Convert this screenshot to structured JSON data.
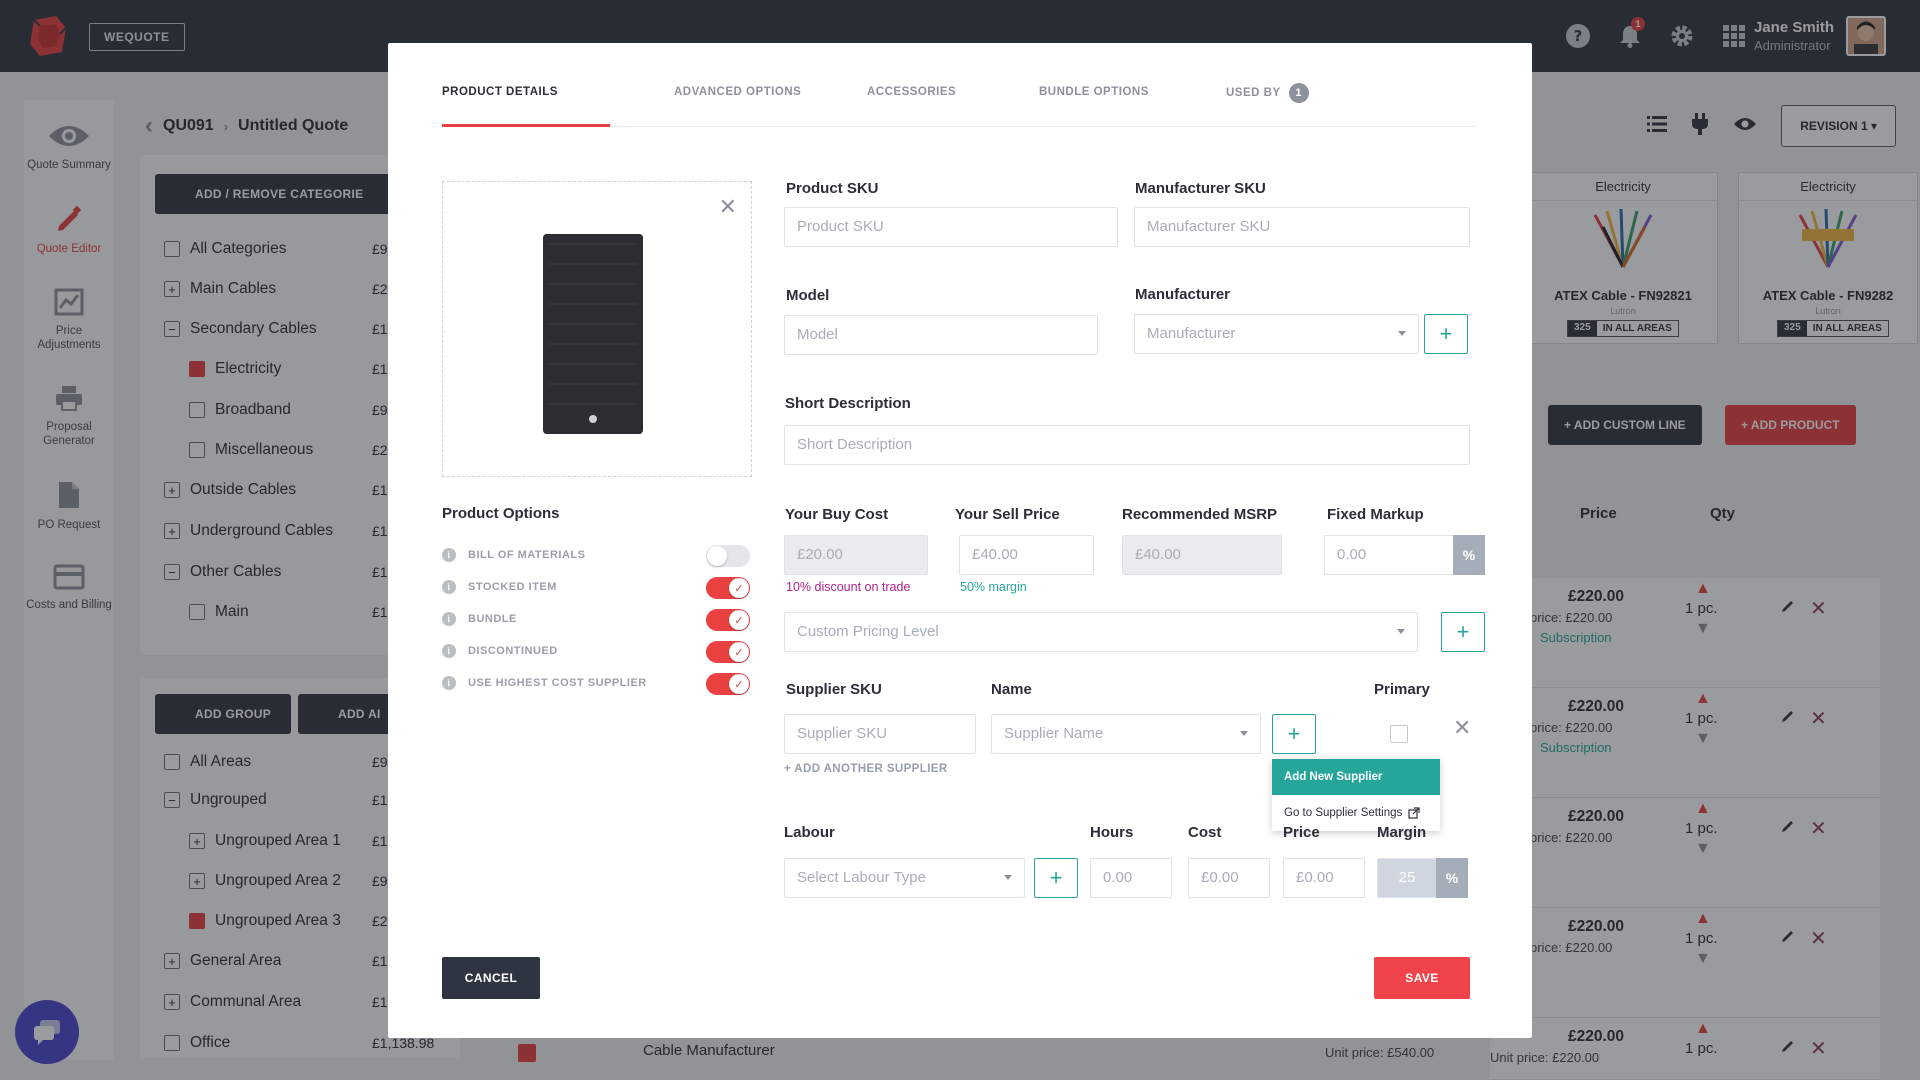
{
  "topbar": {
    "brand": "WEQUOTE",
    "notifications": "1",
    "user_name": "Jane Smith",
    "user_role": "Administrator"
  },
  "rail": [
    {
      "icon": "eye-icon",
      "label": "Quote Summary"
    },
    {
      "icon": "pencil-icon",
      "label": "Quote Editor"
    },
    {
      "icon": "chart-icon",
      "label": "Price Adjustments"
    },
    {
      "icon": "printer-icon",
      "label": "Proposal Generator"
    },
    {
      "icon": "document-icon",
      "label": "PO Request"
    },
    {
      "icon": "card-icon",
      "label": "Costs and Billing"
    }
  ],
  "quote": {
    "id": "QU091",
    "name": "Untitled Quote",
    "revision": "REVISION 1"
  },
  "categories_btn": "ADD / REMOVE CATEGORIE",
  "categories": [
    {
      "label": "All Categories",
      "price": "£9"
    },
    {
      "label": "Main Cables",
      "price": "£2"
    },
    {
      "label": "Secondary Cables",
      "price": "£1"
    },
    {
      "label": "Electricity",
      "price": "£1"
    },
    {
      "label": "Broadband",
      "price": "£9"
    },
    {
      "label": "Miscellaneous",
      "price": "£2"
    },
    {
      "label": "Outside Cables",
      "price": "£1"
    },
    {
      "label": "Underground Cables",
      "price": "£1"
    },
    {
      "label": "Other Cables",
      "price": "£1"
    },
    {
      "label": "Main",
      "price": "£1"
    }
  ],
  "groups_btns": {
    "add_group": "ADD GROUP",
    "add_area": "ADD AI"
  },
  "areas": [
    {
      "label": "All Areas",
      "price": "£9"
    },
    {
      "label": "Ungrouped",
      "price": "£1"
    },
    {
      "label": "Ungrouped Area 1",
      "price": "£1"
    },
    {
      "label": "Ungrouped Area 2",
      "price": "£9"
    },
    {
      "label": "Ungrouped Area 3",
      "price": "£2"
    },
    {
      "label": "General Area",
      "price": "£1"
    },
    {
      "label": "Communal Area",
      "price": "£1"
    },
    {
      "label": "Office",
      "price": "£1,138.98"
    }
  ],
  "cards": [
    {
      "head": "Electricity",
      "name": "ATEX Cable - FN92821",
      "brand": "Lutron",
      "stock": "325",
      "stock_label": "IN ALL AREAS"
    },
    {
      "head": "Electricity",
      "name": "ATEX Cable - FN9282",
      "brand": "Lutron",
      "stock": "325",
      "stock_label": "IN ALL AREAS"
    }
  ],
  "bg_buttons": {
    "custom_line": "ADD CUSTOM LINE",
    "add_product": "ADD PRODUCT"
  },
  "bg_columns": {
    "price": "Price",
    "qty": "Qty"
  },
  "lines": [
    {
      "price": "£220.00",
      "unit": "price: £220.00",
      "sub": "Subscription",
      "qty": "1 pc."
    },
    {
      "price": "£220.00",
      "unit": "price: £220.00",
      "sub": "Subscription",
      "qty": "1 pc."
    },
    {
      "price": "£220.00",
      "unit": "price: £220.00",
      "sub": "",
      "qty": "1 pc."
    },
    {
      "price": "£220.00",
      "unit": "price: £220.00",
      "sub": "",
      "qty": "1 pc."
    },
    {
      "price": "£220.00",
      "unit": "Unit price: £220.00",
      "sub": "",
      "qty": "1 pc."
    }
  ],
  "bottom_row": {
    "label": "Cable Manufacturer",
    "unit": "Unit price: £540.00"
  },
  "modal": {
    "tabs": [
      "PRODUCT DETAILS",
      "ADVANCED OPTIONS",
      "ACCESSORIES",
      "BUNDLE OPTIONS",
      "USED BY"
    ],
    "used_by_count": "1",
    "product_sku_label": "Product SKU",
    "product_sku_ph": "Product SKU",
    "manufacturer_sku_label": "Manufacturer SKU",
    "manufacturer_sku_ph": "Manufacturer SKU",
    "model_label": "Model",
    "model_ph": "Model",
    "manufacturer_label": "Manufacturer",
    "manufacturer_ph": "Manufacturer",
    "short_desc_label": "Short Description",
    "short_desc_ph": "Short Description",
    "product_options_label": "Product Options",
    "options": [
      {
        "label": "BILL OF MATERIALS",
        "on": false
      },
      {
        "label": "STOCKED ITEM",
        "on": true
      },
      {
        "label": "BUNDLE",
        "on": true
      },
      {
        "label": "DISCONTINUED",
        "on": true
      },
      {
        "label": "USE HIGHEST COST SUPPLIER",
        "on": true
      }
    ],
    "buy_cost_label": "Your Buy Cost",
    "buy_cost": "£20.00",
    "buy_note": "10% discount on trade",
    "sell_price_label": "Your Sell Price",
    "sell_price": "£40.00",
    "sell_note": "50% margin",
    "msrp_label": "Recommended MSRP",
    "msrp": "£40.00",
    "markup_label": "Fixed Markup",
    "markup": "0.00",
    "pct": "%",
    "pricing_level_ph": "Custom Pricing Level",
    "supplier_sku_label": "Supplier SKU",
    "supplier_sku_ph": "Supplier SKU",
    "supplier_name_label": "Name",
    "supplier_name_ph": "Supplier Name",
    "primary_label": "Primary",
    "add_supplier": "ADD ANOTHER SUPPLIER",
    "dropdown": {
      "add_new": "Add New Supplier",
      "settings": "Go to Supplier Settings"
    },
    "labour_label": "Labour",
    "labour_ph": "Select Labour Type",
    "hours_label": "Hours",
    "hours": "0.00",
    "cost_label": "Cost",
    "cost": "£0.00",
    "price_label": "Price",
    "price": "£0.00",
    "margin_label": "Margin",
    "margin": "25",
    "cancel": "CANCEL",
    "save": "SAVE"
  },
  "colors": {
    "accent": "#e8413f",
    "teal": "#26a69a",
    "dark": "#2f3540"
  }
}
